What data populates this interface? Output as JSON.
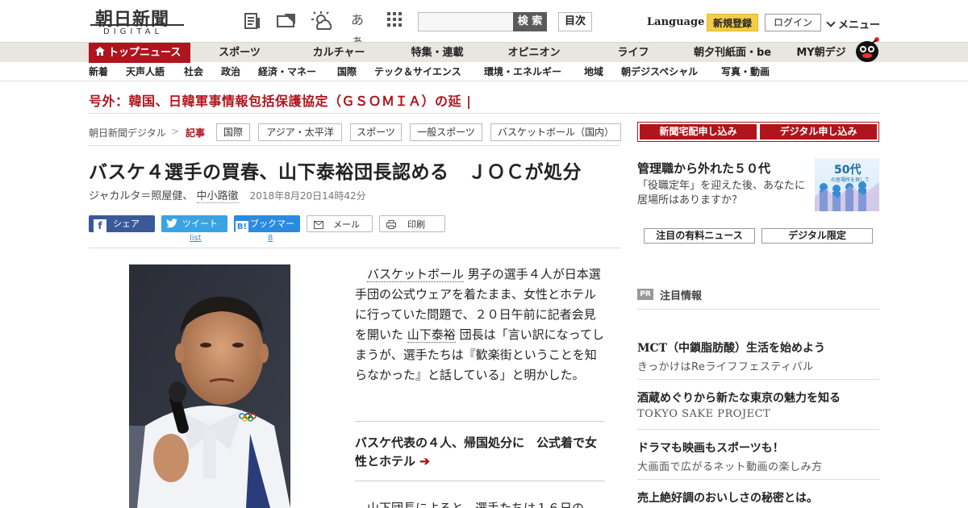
{
  "header": {
    "logo_jp": "朝日新聞",
    "logo_en": "DIGITAL",
    "search_placeholder": "",
    "search_label": "検 索",
    "toc_label": "目次",
    "language_label": "Language",
    "signup_label": "新規登録",
    "login_label": "ログイン",
    "menu_label": "メニュー",
    "kana_label": "あぁ"
  },
  "mainnav": {
    "items": [
      "トップニュース",
      "スポーツ",
      "カルチャー",
      "特集・連載",
      "オピニオン",
      "ライフ",
      "朝夕刊紙面・be",
      "MY朝デジ"
    ]
  },
  "subnav": {
    "items": [
      "新着",
      "天声人語",
      "社会",
      "政治",
      "経済・マネー",
      "国際",
      "テック＆サイエンス",
      "環境・エネルギー",
      "地域",
      "朝デジスペシャル",
      "写真・動画"
    ]
  },
  "breaking": "号外：韓国、日韓軍事情報包括保護協定（ＧＳＯＭＩＡ）の延 |",
  "breadcrumb": {
    "site": "朝日新聞デジタル",
    "sep": ">",
    "current": "記事",
    "tags": [
      "国際",
      "アジア・太平洋",
      "スポーツ",
      "一般スポーツ",
      "バスケットボール（国内）"
    ]
  },
  "article": {
    "title": "バスケ４選手の買春、山下泰裕団長認める　ＪＯＣが処分",
    "author1": "ジャカルタ＝照屋健、",
    "author2": "中小路徹",
    "date": "2018年8月20日14時42分",
    "body_link1": "バスケットボール",
    "body_part1": " 男子の選手４人が日本選手団の公式ウェアを着たまま、女性とホテルに行っていた問題で、２０日午前に記者会見を開いた ",
    "body_link2": "山下泰裕",
    "body_part2": " 団長は「言い訳になってしまうが、選手たちは『歓楽街ということを知らなかった』と話している」と明かした。",
    "related": "バスケ代表の４人、帰国処分に　公式着で女性とホテル",
    "related_arrow": "➔",
    "body_next": "　山下団長によると、選手たちは１６日の"
  },
  "share": {
    "facebook": "シェア",
    "twitter": "ツイート",
    "twitter_count": "list",
    "hatena": "ブックマーク",
    "hatena_count": "8",
    "mail": "メール",
    "print": "印刷"
  },
  "sidebar": {
    "subscribe_paper": "新聞宅配申し込み",
    "subscribe_digital": "デジタル申し込み",
    "ad_title": "管理職から外れた５０代",
    "ad_text": "「役職定年」を迎えた後、あなたに居場所はありますか？",
    "ad_image_title": "50代",
    "ad_image_sub": "の居場所を探して",
    "btn_featured": "注目の有料ニュース",
    "btn_digital": "デジタル限定",
    "pr_badge": "PR",
    "pr_label": "注目情報",
    "pr_items": [
      {
        "title": "MCT（中鎖脂肪酸）生活を始めよう",
        "sub": "きっかけはReライフフェスティバル"
      },
      {
        "title": "酒蔵めぐりから新たな東京の魅力を知る",
        "sub": "TOKYO SAKE PROJECT"
      },
      {
        "title": "ドラマも映画もスポーツも！",
        "sub": "大画面で広がるネット動画の楽しみ方"
      },
      {
        "title": "売上絶好調のおいしさの秘密とは。",
        "sub": ""
      }
    ]
  },
  "colors": {
    "brand_red": "#b0141c",
    "signup_yellow": "#f4cc47"
  }
}
